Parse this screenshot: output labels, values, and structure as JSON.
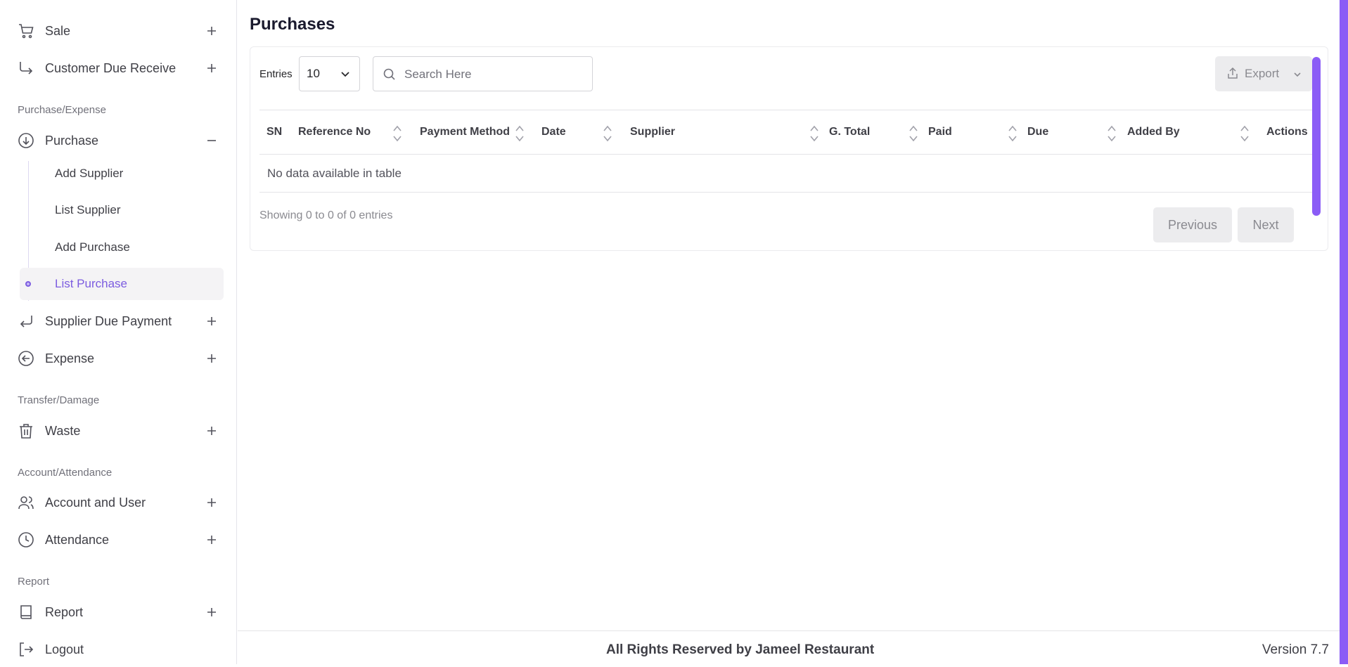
{
  "sidebar": {
    "items": [
      {
        "label": "Sale",
        "icon": "cart-icon"
      },
      {
        "label": "Customer Due Receive",
        "icon": "arrow-down-right-icon"
      },
      {
        "label": "Purchase",
        "icon": "arrow-down-circle-icon"
      },
      {
        "label": "Supplier Due Payment",
        "icon": "arrow-return-left-icon"
      },
      {
        "label": "Expense",
        "icon": "arrow-left-circle-icon"
      },
      {
        "label": "Waste",
        "icon": "trash-icon"
      },
      {
        "label": "Account and User",
        "icon": "users-icon"
      },
      {
        "label": "Attendance",
        "icon": "clock-icon"
      },
      {
        "label": "Report",
        "icon": "book-icon"
      },
      {
        "label": "Logout",
        "icon": "logout-icon"
      }
    ],
    "sections": [
      "Purchase/Expense",
      "Transfer/Damage",
      "Account/Attendance",
      "Report"
    ],
    "purchase_sub": [
      "Add Supplier",
      "List Supplier",
      "Add Purchase",
      "List Purchase"
    ],
    "active_sub": "List Purchase"
  },
  "main": {
    "title": "Purchases",
    "entries_label": "Entries",
    "entries_value": "10",
    "search_placeholder": "Search Here",
    "export_label": "Export",
    "columns": [
      "SN",
      "Reference No",
      "Payment Method",
      "Date",
      "Supplier",
      "G. Total",
      "Paid",
      "Due",
      "Added By",
      "Actions"
    ],
    "empty_message": "No data available in table",
    "info": "Showing 0 to 0 of 0 entries",
    "prev_label": "Previous",
    "next_label": "Next"
  },
  "footer": {
    "copyright": "All Rights Reserved by Jameel Restaurant",
    "version": "Version 7.7"
  },
  "colors": {
    "accent": "#8b5cf6",
    "active_text": "#7c5ce0"
  }
}
